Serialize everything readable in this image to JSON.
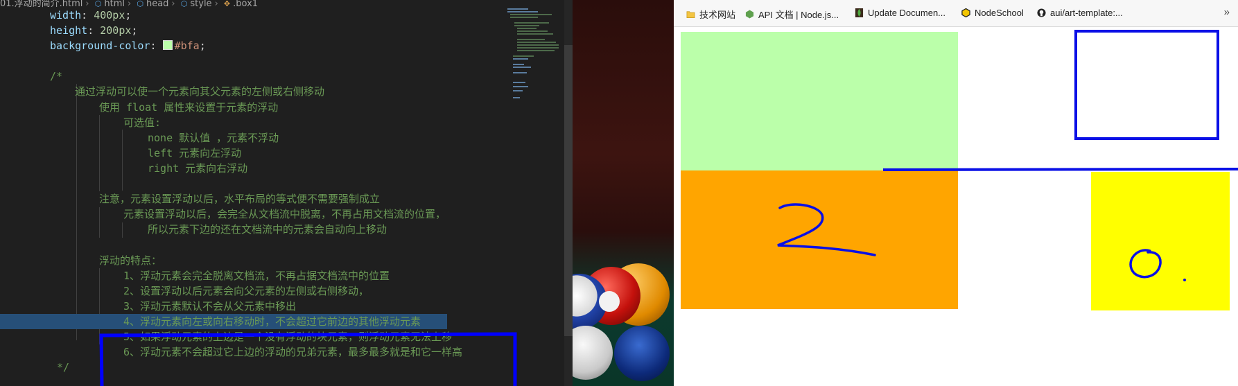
{
  "editor": {
    "breadcrumb": [
      "01.浮动的简介.html",
      "html",
      "head",
      "style",
      ".box1"
    ],
    "lines": [
      "width: 400px;",
      "height: 200px;",
      "background-color: #bfa;",
      "",
      "/*",
      "通过浮动可以使一个元素向其父元素的左侧或右侧移动",
      "使用 float 属性来设置于元素的浮动",
      "可选值:",
      "none 默认值 ，元素不浮动",
      "left 元素向左浮动",
      "right 元素向右浮动",
      "",
      "注意，元素设置浮动以后，水平布局的等式便不需要强制成立",
      "元素设置浮动以后，会完全从文档流中脱离，不再占用文档流的位置，",
      "所以元素下边的还在文档流中的元素会自动向上移动",
      "",
      "浮动的特点：",
      "1、浮动元素会完全脱离文档流，不再占据文档流中的位置",
      "2、设置浮动以后元素会向父元素的左侧或右侧移动，",
      "3、浮动元素默认不会从父元素中移出",
      "4、浮动元素向左或向右移动时，不会超过它前边的其他浮动元素",
      "5、如果浮动元素的上边是一个没有浮动的块元素，则浮动元素无法上移",
      "6、浮动元素不会超过它上边的浮动的兄弟元素，最多最多就是和它一样高",
      "*/"
    ]
  },
  "browser": {
    "bookmarks": [
      {
        "label": "技术网站",
        "icon": "folder-icon"
      },
      {
        "label": "API 文档 | Node.js...",
        "icon": "nodejs-icon"
      },
      {
        "label": "Update Documen...",
        "icon": "mongodb-leaf-icon"
      },
      {
        "label": "NodeSchool",
        "icon": "nodeschool-hex-icon"
      },
      {
        "label": "aui/art-template:...",
        "icon": "github-icon"
      }
    ],
    "more_label": "»"
  },
  "colors": {
    "box1": "#bbffaa",
    "box2": "#ffa500",
    "box3": "#ffff00",
    "annotation": "#0000ff"
  }
}
